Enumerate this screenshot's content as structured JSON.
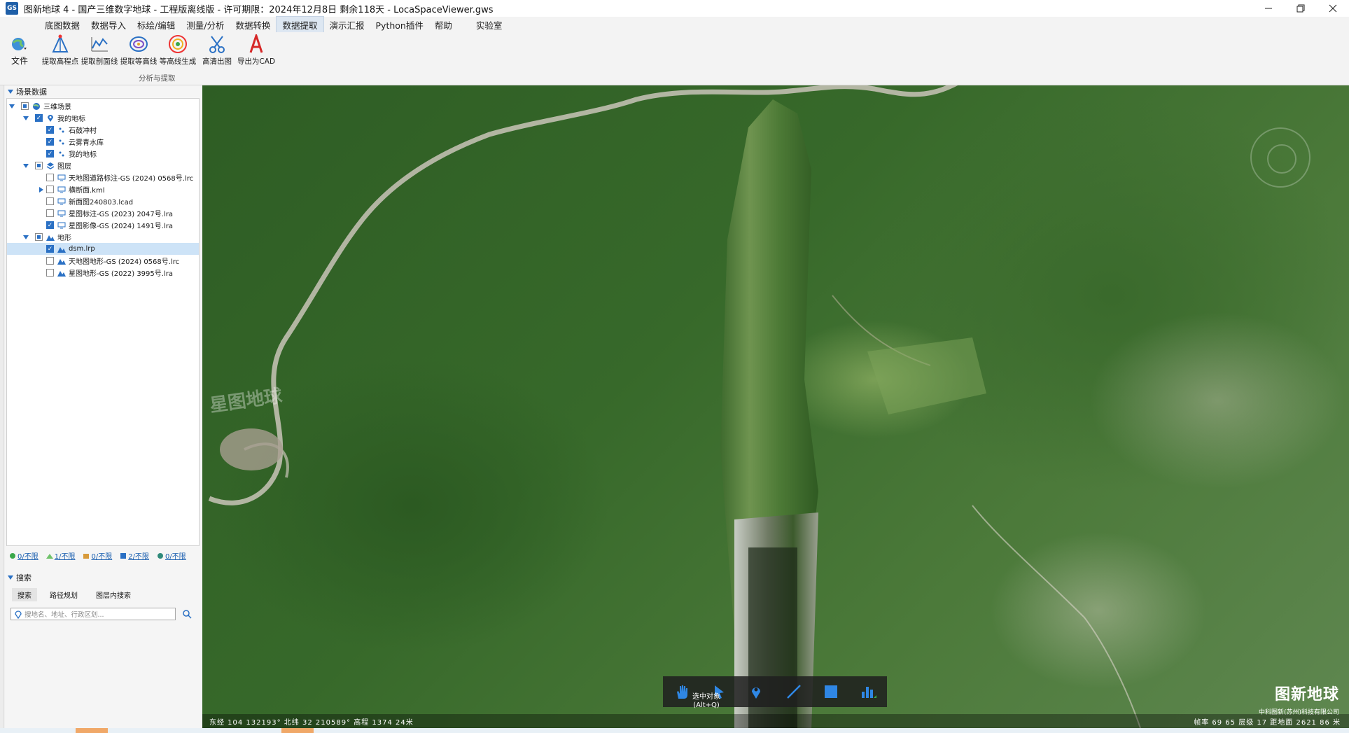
{
  "window": {
    "title": "图新地球 4 - 国产三维数字地球 - 工程版离线版 - 许可期限：2024年12月8日 剩余118天 - LocaSpaceViewer.gws",
    "logo_text": "GS"
  },
  "menu": {
    "items": [
      "底图数据",
      "数据导入",
      "标绘/编辑",
      "测量/分析",
      "数据转换",
      "数据提取",
      "演示汇报",
      "Python插件",
      "帮助",
      "实验室"
    ],
    "active": "数据提取"
  },
  "ribbon": {
    "file_label": "文件",
    "tools": [
      {
        "label": "提取高程点",
        "icon": "elevation-point-icon"
      },
      {
        "label": "提取剖面线",
        "icon": "profile-line-icon"
      },
      {
        "label": "提取等高线",
        "icon": "contour-icon"
      },
      {
        "label": "等高线生成",
        "icon": "contour-generate-icon"
      },
      {
        "label": "高清出图",
        "icon": "hd-export-icon"
      },
      {
        "label": "导出为CAD",
        "icon": "cad-export-icon"
      }
    ],
    "group_label": "分析与提取"
  },
  "scene_panel": {
    "header": "场景数据",
    "tree": {
      "root": "三维场景",
      "my_marks": "我的地标",
      "mark_items": [
        "石鼓冲村",
        "云雾青水库",
        "我的地标"
      ],
      "layers": "图层",
      "layer_items": [
        "天地图道路标注-GS (2024) 0568号.lrc",
        "横断面.kml",
        "新面图240803.lcad",
        "星图标注-GS (2023) 2047号.lra",
        "星图影像-GS (2024) 1491号.lra"
      ],
      "terrain": "地形",
      "terrain_items": [
        "dsm.lrp",
        "天地图地形-GS (2024) 0568号.lrc",
        "星图地形-GS (2022) 3995号.lra"
      ]
    }
  },
  "status_counts": [
    "0/不限",
    "1/不限",
    "0/不限",
    "2/不限",
    "0/不限"
  ],
  "search_panel": {
    "header": "搜索",
    "tabs": [
      "搜索",
      "路径规划",
      "图层内搜索"
    ],
    "placeholder": "搜地名、地址、行政区划..."
  },
  "map": {
    "watermark": "星图地球",
    "tooltip_line1": "选中对象",
    "tooltip_line2": "(Alt+Q)",
    "brand_title": "图新地球",
    "brand_sub": "中科图新(苏州)科技有限公司",
    "coord_left": "东经 104 132193°  北纬 32 210589°  高程 1374 24米",
    "coord_right": "帧率 69 65  层级 17  距地面 2621 86 米"
  },
  "colors": {
    "accent": "#2a70c4",
    "selection": "#cde3f7"
  }
}
